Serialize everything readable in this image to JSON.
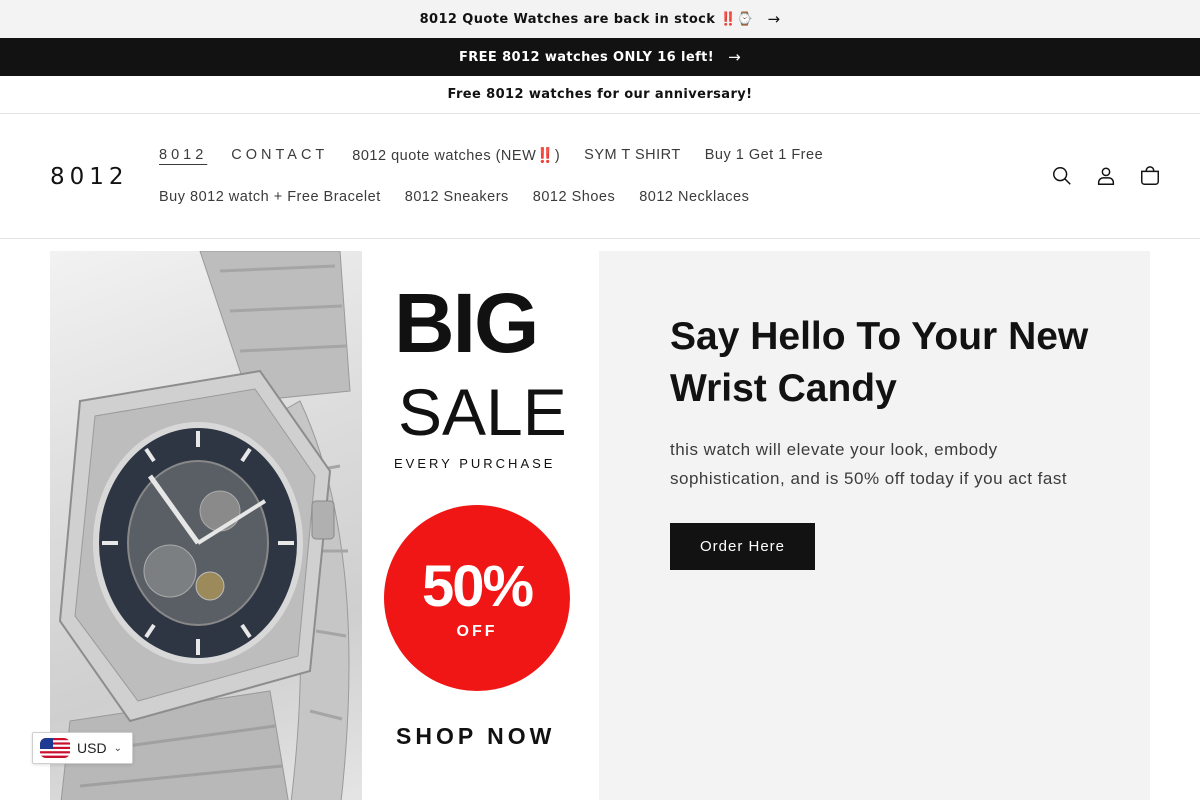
{
  "announcements": [
    {
      "text": "8012 Quote Watches are back in stock ‼️⌚",
      "has_arrow": true
    },
    {
      "text": "FREE 8012 watches ONLY 16 left!",
      "has_arrow": true
    },
    {
      "text": "Free 8012 watches for our anniversary!",
      "has_arrow": false
    }
  ],
  "arrow_glyph": "→",
  "header": {
    "logo": "8012",
    "nav": {
      "row1": [
        "8012",
        "CONTACT",
        "8012 quote watches (NEW‼️)",
        "SYM T SHIRT",
        "Buy 1 Get 1 Free"
      ],
      "row2": [
        "Buy 8012 watch + Free Bracelet",
        "8012 Sneakers",
        "8012 Shoes",
        "8012 Necklaces"
      ]
    },
    "icons": [
      "search-icon",
      "account-icon",
      "cart-icon"
    ]
  },
  "banner": {
    "image_text": {
      "big": "BIG",
      "sale": "SALE",
      "every": "EVERY PURCHASE",
      "percent": "50%",
      "off": "OFF",
      "shop": "SHOP NOW"
    },
    "heading": "Say Hello To Your New Wrist Candy",
    "text": "this watch will elevate your look, embody sophistication, and is 50% off today if you act fast",
    "button": "Order Here"
  },
  "currency": {
    "code": "USD",
    "flag": "us-flag-icon"
  },
  "colors": {
    "dark": "#121212",
    "sale_red": "#f01616",
    "banner_bg": "#f3f3f3"
  }
}
